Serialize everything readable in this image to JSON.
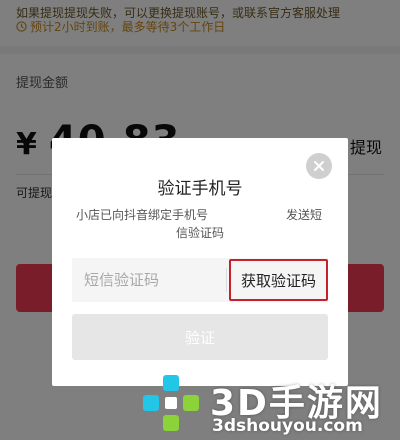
{
  "background_page": {
    "notice_line": "如果提现提现失败，可以更换提现账号，或联系官方客服处理",
    "eta_notice": "预计2小时到账，最多等待3个工作日",
    "withdraw_label": "提现金额",
    "currency_symbol": "¥",
    "amount": "40.83",
    "withdraw_all_label": "提现",
    "available_text": "可提现",
    "colors": {
      "confirm_button": "#f23a55",
      "eta_text": "#c98a1c"
    }
  },
  "modal": {
    "title": "验证手机号",
    "description_line1": "小店已向抖音绑定手机号",
    "description_send": "发送短",
    "description_line2": "信验证码",
    "code_input": {
      "placeholder": "短信验证码",
      "value": ""
    },
    "get_code_label": "获取验证码",
    "verify_label": "验证",
    "close_icon": "close-icon",
    "colors": {
      "highlight_border": "#c6202c",
      "verify_button_bg": "#e6e6e6"
    }
  },
  "watermark": {
    "title": "3D手游网",
    "url": "3dshouyou.com",
    "colors": {
      "logo_cyan": "#22c7e8",
      "logo_green": "#8cd33a"
    }
  }
}
